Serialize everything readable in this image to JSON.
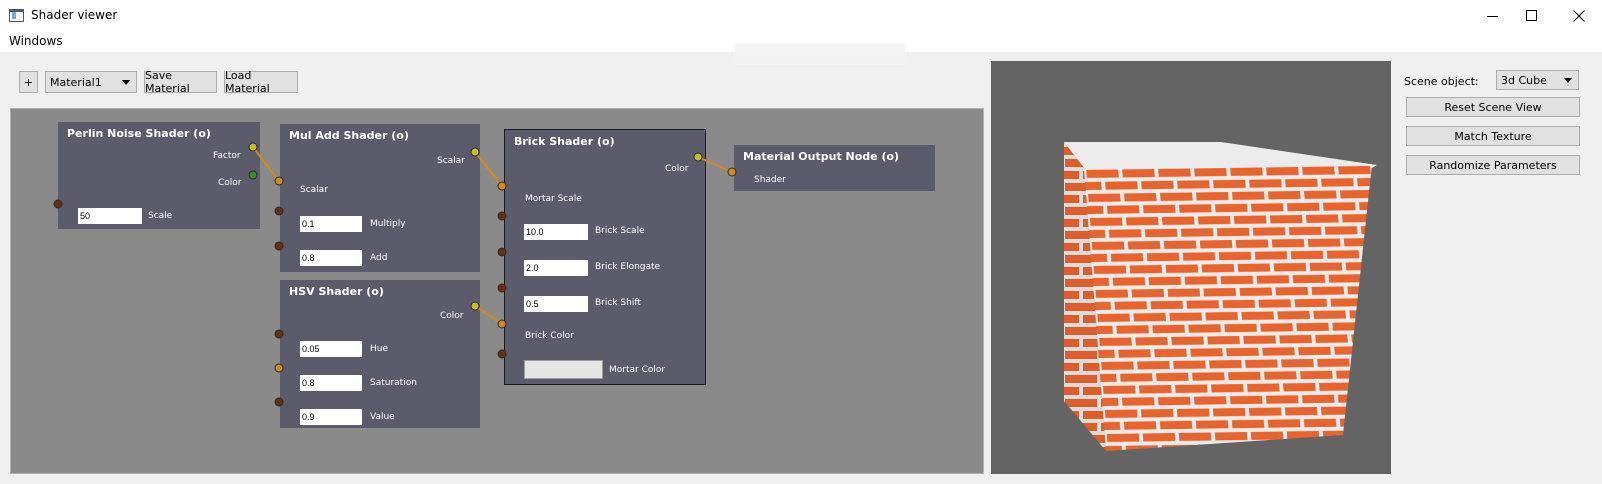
{
  "window": {
    "title": "Shader viewer"
  },
  "menu": {
    "items": [
      "Windows"
    ]
  },
  "toolbar": {
    "add_label": "+",
    "material_selected": "Material1",
    "save_label": "Save Material",
    "load_label": "Load Material"
  },
  "nodes": {
    "perlin": {
      "title": "Perlin Noise Shader (o)",
      "factor": "Factor",
      "color": "Color",
      "scale_value": "50",
      "scale_label": "Scale"
    },
    "muladd": {
      "title": "Mul Add Shader (o)",
      "scalar_out": "Scalar",
      "scalar_in": "Scalar",
      "multiply_value": "0.1",
      "multiply_label": "Multiply",
      "add_value": "0.8",
      "add_label": "Add"
    },
    "hsv": {
      "title": "HSV Shader (o)",
      "color_out": "Color",
      "hue_value": "0.05",
      "hue_label": "Hue",
      "saturation_value": "0.8",
      "saturation_label": "Saturation",
      "value_value": "0.9",
      "value_label": "Value"
    },
    "brick": {
      "title": "Brick Shader (o)",
      "color_out": "Color",
      "mortar_scale": "Mortar Scale",
      "brick_scale_value": "10.0",
      "brick_scale_label": "Brick Scale",
      "elongate_value": "2.0",
      "elongate_label": "Brick Elongate",
      "shift_value": "0.5",
      "shift_label": "Brick Shift",
      "brick_color": "Brick Color",
      "mortar_color": "Mortar Color"
    },
    "output": {
      "title": "Material Output Node (o)",
      "shader": "Shader"
    }
  },
  "side_panel": {
    "scene_object_label": "Scene object:",
    "scene_object_value": "3d Cube",
    "reset_label": "Reset Scene View",
    "match_label": "Match Texture",
    "randomize_label": "Randomize Parameters"
  },
  "colors": {
    "brick": "#e8642c",
    "mortar": "#ececec",
    "node_bg": "#5c5b6b",
    "editor_bg": "#8a8a8a",
    "wire": "#d28a1e"
  }
}
